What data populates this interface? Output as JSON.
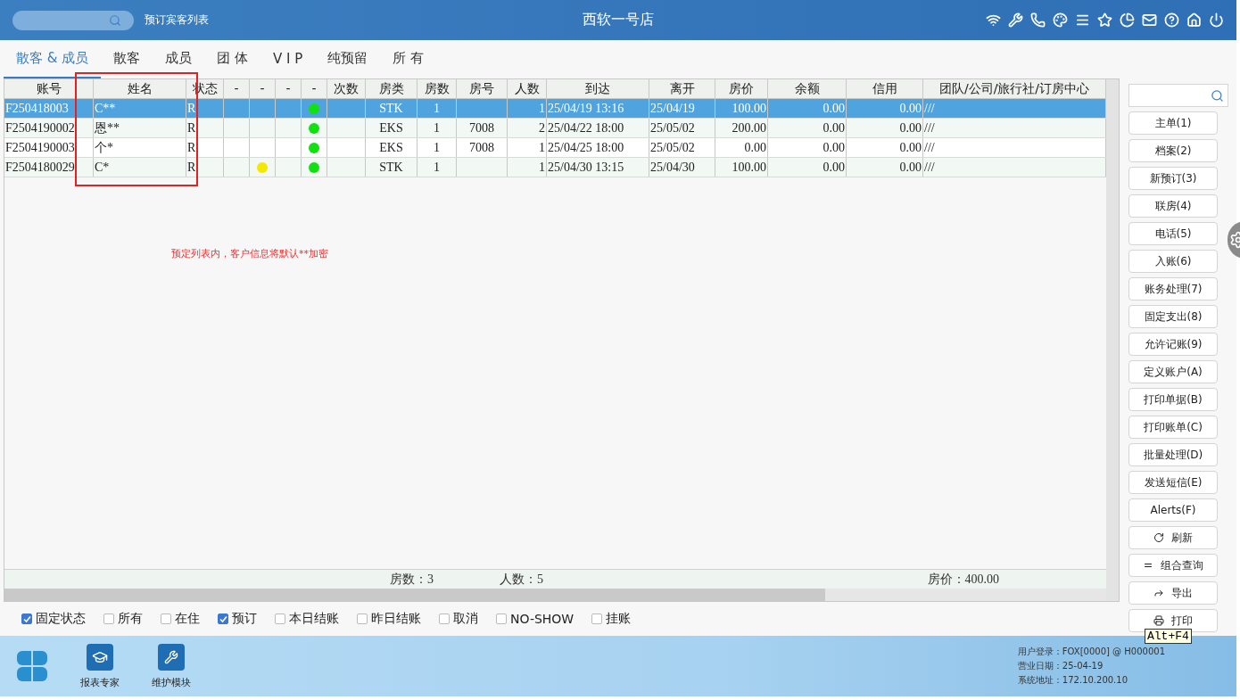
{
  "top_bar": {
    "page_title": "预订宾客列表",
    "hotel_name": "西软一号店"
  },
  "tabs": [
    {
      "label": "散客 & 成员",
      "selected": true
    },
    {
      "label": "散客",
      "selected": false
    },
    {
      "label": "成员",
      "selected": false
    },
    {
      "label": "团 体",
      "selected": false
    },
    {
      "label": "V I P",
      "selected": false
    },
    {
      "label": "纯预留",
      "selected": false
    },
    {
      "label": "所 有",
      "selected": false
    }
  ],
  "table": {
    "columns": [
      "账号",
      "姓名",
      "状态",
      "-",
      "-",
      "-",
      "-",
      "次数",
      "房类",
      "房数",
      "房号",
      "人数",
      "到达",
      "离开",
      "房价",
      "余额",
      "信用",
      "团队/公司/旅行社/订房中心"
    ],
    "rows": [
      {
        "selected": true,
        "cells": [
          {
            "kind": "text",
            "text": "F250418003"
          },
          {
            "kind": "text",
            "text": "C**"
          },
          {
            "kind": "text",
            "text": "R"
          },
          {
            "kind": "blank"
          },
          {
            "kind": "blank"
          },
          {
            "kind": "blank"
          },
          {
            "kind": "dot",
            "color": "#11e011"
          },
          {
            "kind": "blank"
          },
          {
            "kind": "text",
            "text": "STK"
          },
          {
            "kind": "text",
            "text": "1"
          },
          {
            "kind": "blank"
          },
          {
            "kind": "text",
            "text": "1"
          },
          {
            "kind": "text",
            "text": "25/04/19 13:16"
          },
          {
            "kind": "text",
            "text": "25/04/19"
          },
          {
            "kind": "text",
            "text": "100.00"
          },
          {
            "kind": "text",
            "text": "0.00"
          },
          {
            "kind": "text",
            "text": "0.00"
          },
          {
            "kind": "text",
            "text": "///"
          }
        ]
      },
      {
        "selected": false,
        "cells": [
          {
            "kind": "text",
            "text": "F2504190002"
          },
          {
            "kind": "text",
            "text": "恩**"
          },
          {
            "kind": "text",
            "text": "R"
          },
          {
            "kind": "blank"
          },
          {
            "kind": "blank"
          },
          {
            "kind": "blank"
          },
          {
            "kind": "dot",
            "color": "#11e011"
          },
          {
            "kind": "blank"
          },
          {
            "kind": "text",
            "text": "EKS"
          },
          {
            "kind": "text",
            "text": "1"
          },
          {
            "kind": "text",
            "text": "7008"
          },
          {
            "kind": "text",
            "text": "2"
          },
          {
            "kind": "text",
            "text": "25/04/22 18:00"
          },
          {
            "kind": "text",
            "text": "25/05/02"
          },
          {
            "kind": "text",
            "text": "200.00"
          },
          {
            "kind": "text",
            "text": "0.00"
          },
          {
            "kind": "text",
            "text": "0.00"
          },
          {
            "kind": "text",
            "text": "///"
          }
        ]
      },
      {
        "selected": false,
        "cells": [
          {
            "kind": "text",
            "text": "F2504190003"
          },
          {
            "kind": "text",
            "text": "个*"
          },
          {
            "kind": "text",
            "text": "R"
          },
          {
            "kind": "blank"
          },
          {
            "kind": "blank"
          },
          {
            "kind": "blank"
          },
          {
            "kind": "dot",
            "color": "#11e011"
          },
          {
            "kind": "blank"
          },
          {
            "kind": "text",
            "text": "EKS"
          },
          {
            "kind": "text",
            "text": "1"
          },
          {
            "kind": "text",
            "text": "7008"
          },
          {
            "kind": "text",
            "text": "1"
          },
          {
            "kind": "text",
            "text": "25/04/25 18:00"
          },
          {
            "kind": "text",
            "text": "25/05/02"
          },
          {
            "kind": "text",
            "text": "0.00"
          },
          {
            "kind": "text",
            "text": "0.00"
          },
          {
            "kind": "text",
            "text": "0.00"
          },
          {
            "kind": "text",
            "text": "///"
          }
        ]
      },
      {
        "selected": false,
        "cells": [
          {
            "kind": "text",
            "text": "F2504180029"
          },
          {
            "kind": "text",
            "text": "C*"
          },
          {
            "kind": "text",
            "text": "R"
          },
          {
            "kind": "blank"
          },
          {
            "kind": "dot",
            "color": "#f5e800"
          },
          {
            "kind": "blank"
          },
          {
            "kind": "dot",
            "color": "#11e011"
          },
          {
            "kind": "blank"
          },
          {
            "kind": "text",
            "text": "STK"
          },
          {
            "kind": "text",
            "text": "1"
          },
          {
            "kind": "blank"
          },
          {
            "kind": "text",
            "text": "1"
          },
          {
            "kind": "text",
            "text": "25/04/30 13:15"
          },
          {
            "kind": "text",
            "text": "25/04/30"
          },
          {
            "kind": "text",
            "text": "100.00"
          },
          {
            "kind": "text",
            "text": "0.00"
          },
          {
            "kind": "text",
            "text": "0.00"
          },
          {
            "kind": "text",
            "text": "///"
          }
        ]
      }
    ],
    "note": "预定列表内，客户信息将默认**加密",
    "totals": {
      "rooms": "房数：3",
      "guests": "人数：5",
      "rate": "房价：400.00"
    }
  },
  "filters": [
    {
      "label": "固定状态",
      "checked": true
    },
    {
      "label": "所有",
      "checked": false
    },
    {
      "label": "在住",
      "checked": false
    },
    {
      "label": "预订",
      "checked": true
    },
    {
      "label": "本日结账",
      "checked": false
    },
    {
      "label": "昨日结账",
      "checked": false
    },
    {
      "label": "取消",
      "checked": false
    },
    {
      "label": "NO-SHOW",
      "checked": false
    },
    {
      "label": "挂账",
      "checked": false
    }
  ],
  "side_panel": {
    "buttons": [
      {
        "kind": "text",
        "label": "主单(1)"
      },
      {
        "kind": "text",
        "label": "档案(2)"
      },
      {
        "kind": "text",
        "label": "新预订(3)"
      },
      {
        "kind": "text",
        "label": "联房(4)"
      },
      {
        "kind": "text",
        "label": "电话(5)"
      },
      {
        "kind": "text",
        "label": "入账(6)"
      },
      {
        "kind": "text",
        "label": "账务处理(7)"
      },
      {
        "kind": "text",
        "label": "固定支出(8)"
      },
      {
        "kind": "text",
        "label": "允许记账(9)"
      },
      {
        "kind": "text",
        "label": "定义账户(A)"
      },
      {
        "kind": "text",
        "label": "打印单据(B)"
      },
      {
        "kind": "text",
        "label": "打印账单(C)"
      },
      {
        "kind": "text",
        "label": "批量处理(D)"
      },
      {
        "kind": "text",
        "label": "发送短信(E)"
      },
      {
        "kind": "text",
        "label": "Alerts(F)"
      },
      {
        "kind": "refresh",
        "label": "刷新"
      },
      {
        "kind": "list",
        "label": "组合查询"
      },
      {
        "kind": "export",
        "label": "导出"
      },
      {
        "kind": "print",
        "label": "打印"
      }
    ],
    "tooltip": "Alt+F4"
  },
  "bottom_bar": {
    "modules": [
      {
        "kind": "report",
        "label": "报表专家"
      },
      {
        "kind": "maintenance",
        "label": "维护模块"
      }
    ],
    "session": [
      "用户登录：FOX[0000] @ H000001",
      "营业日期：25-04-19",
      "系统地址：172.10.200.10"
    ]
  }
}
